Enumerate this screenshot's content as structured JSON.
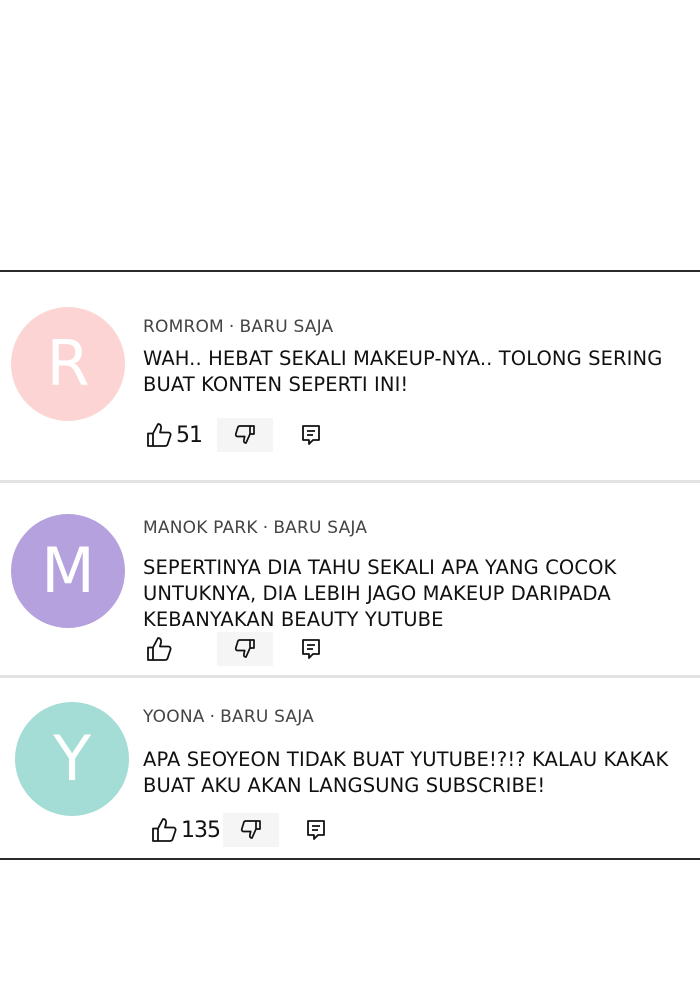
{
  "comments": [
    {
      "avatar_letter": "R",
      "avatar_color": "#fdd4d4",
      "author": "ROMROM",
      "separator": "·",
      "time": "BARU SAJA",
      "text": "WAH.. HEBAT SEKALI MAKEUP-NYA.. TOLONG SERING BUAT KONTEN SEPERTI INI!",
      "likes": "51"
    },
    {
      "avatar_letter": "M",
      "avatar_color": "#b4a1de",
      "author": "MANOK PARK",
      "separator": "·",
      "time": "BARU SAJA",
      "text": "SEPERTINYA DIA TAHU SEKALI APA YANG COCOK UNTUKNYA, DIA LEBIH JAGO MAKEUP DARIPADA KEBANYAKAN BEAUTY YUTUBE",
      "likes": ""
    },
    {
      "avatar_letter": "Y",
      "avatar_color": "#a3ddd6",
      "author": "YOONA",
      "separator": "·",
      "time": "BARU SAJA",
      "text": "APA SEOYEON TIDAK BUAT YUTUBE!?!? KALAU KAKAK BUAT AKU AKAN LANGSUNG SUBSCRIBE!",
      "likes": "135"
    }
  ],
  "icons": {
    "like": "thumbs-up-icon",
    "dislike": "thumbs-down-icon",
    "reply": "reply-comment-icon"
  }
}
